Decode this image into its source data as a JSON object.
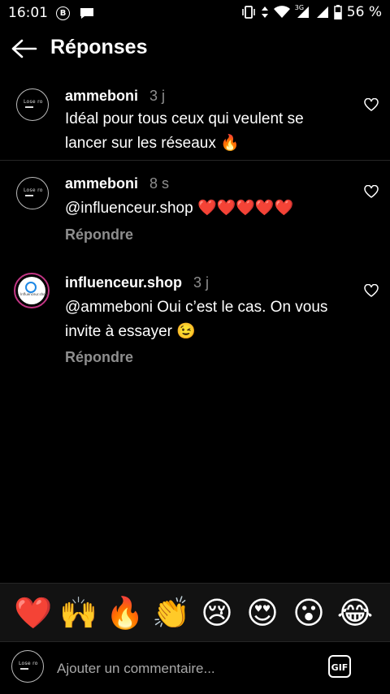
{
  "status_bar": {
    "time": "16:01",
    "bitcoin_glyph": "B",
    "network": "3G",
    "battery": "56 %"
  },
  "header": {
    "title": "Réponses"
  },
  "comments": [
    {
      "username": "ammeboni",
      "time": "3 j",
      "text": "Idéal pour tous ceux qui veulent se lancer sur les réseaux 🔥",
      "avatar_label": "Lose ro"
    },
    {
      "username": "ammeboni",
      "time": "8 s",
      "text": "@influenceur.shop ❤️❤️❤️❤️❤️",
      "reply": "Répondre",
      "avatar_label": "Lose ro"
    },
    {
      "username": "influenceur.shop",
      "time": "3 j",
      "text": "@ammeboni Oui c’est le cas. On vous invite à essayer 😉",
      "reply": "Répondre",
      "avatar_label": "Influenceur.shop"
    }
  ],
  "emoji_bar": [
    "❤️",
    "🙌",
    "🔥",
    "👏",
    "😢",
    "😍",
    "😮",
    "😂"
  ],
  "comment_input": {
    "placeholder": "Ajouter un commentaire...",
    "gif_label": "GIF",
    "avatar_label": "Lose ro"
  },
  "colors": {
    "background": "#000000",
    "secondary_text": "#8e8e8e",
    "divider": "#262626",
    "story_ring": "#c13584"
  }
}
